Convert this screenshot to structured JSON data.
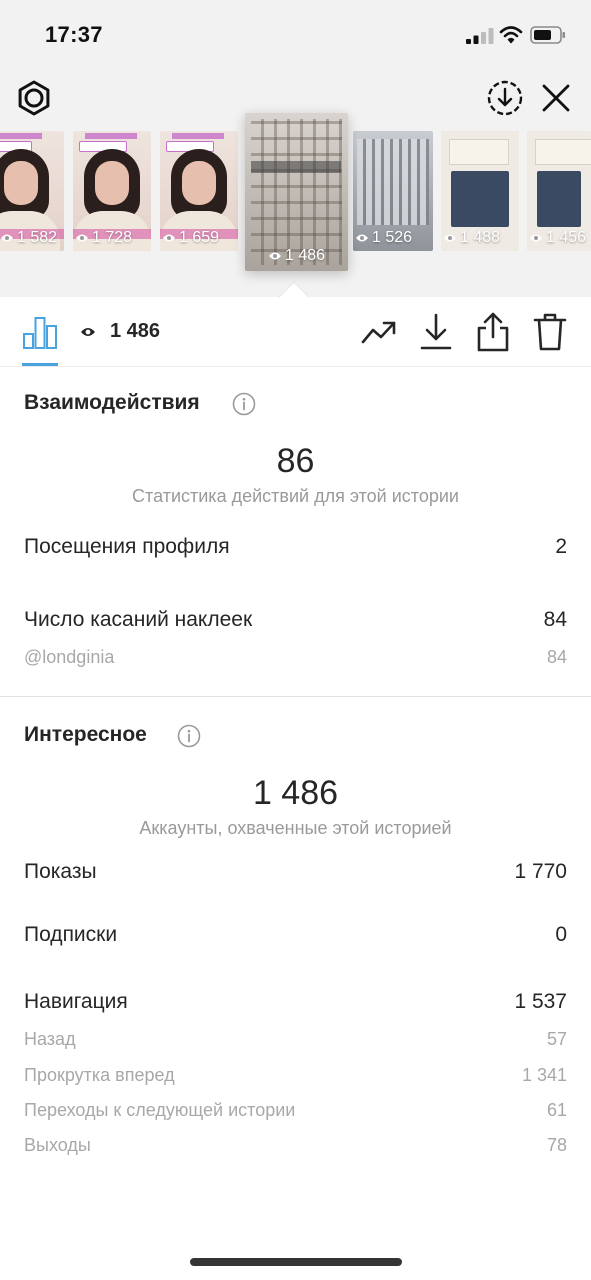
{
  "status_bar": {
    "time": "17:37"
  },
  "stories": [
    {
      "views": "1 582",
      "kind": "person"
    },
    {
      "views": "1 728",
      "kind": "person"
    },
    {
      "views": "1 659",
      "kind": "person"
    },
    {
      "views": "1 486",
      "kind": "building",
      "selected": true
    },
    {
      "views": "1 526",
      "kind": "street"
    },
    {
      "views": "1 488",
      "kind": "screen"
    },
    {
      "views": "1 456",
      "kind": "screen"
    }
  ],
  "toolbar": {
    "views": "1 486",
    "icons": [
      "bar-chart-icon",
      "eye-icon",
      "trend-up-icon",
      "download-icon",
      "share-icon",
      "trash-icon"
    ]
  },
  "interactions": {
    "title": "Взаимодействия",
    "total": "86",
    "caption": "Статистика действий для этой истории",
    "rows": [
      {
        "label": "Посещения профиля",
        "value": "2"
      },
      {
        "label": "Число касаний наклеек",
        "value": "84"
      }
    ],
    "sub_rows": [
      {
        "label": "@londginia",
        "value": "84"
      }
    ]
  },
  "discovery": {
    "title": "Интересное",
    "total": "1 486",
    "caption": "Аккаунты, охваченные этой историей",
    "rows": [
      {
        "label": "Показы",
        "value": "1 770"
      },
      {
        "label": "Подписки",
        "value": "0"
      },
      {
        "label": "Навигация",
        "value": "1 537"
      }
    ],
    "navigation_rows": [
      {
        "label": "Назад",
        "value": "57"
      },
      {
        "label": "Прокрутка вперед",
        "value": "1 341"
      },
      {
        "label": "Переходы к следующей истории",
        "value": "61"
      },
      {
        "label": "Выходы",
        "value": "78"
      }
    ]
  },
  "colors": {
    "accent": "#4aa3df",
    "text": "#262626",
    "secondary": "#9a9a9a",
    "top_bg": "#f2f2f2"
  }
}
